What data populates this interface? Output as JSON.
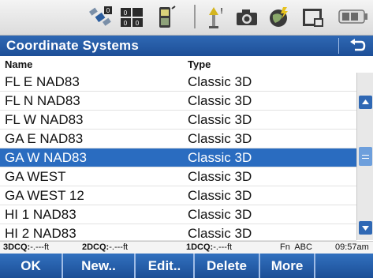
{
  "toolbar": {
    "icons": [
      "gps-satellite-icon",
      "correction-status-icon",
      "data-collector-icon",
      "tilt-sensor-icon",
      "camera-icon",
      "internet-globe-icon",
      "status-screen-icon",
      "battery-icon"
    ]
  },
  "header": {
    "title": "Coordinate Systems"
  },
  "columns": {
    "name": "Name",
    "type": "Type"
  },
  "rows": [
    {
      "name": "FL E NAD83",
      "type": "Classic 3D",
      "selected": false
    },
    {
      "name": "FL N NAD83",
      "type": "Classic 3D",
      "selected": false
    },
    {
      "name": "FL W NAD83",
      "type": "Classic 3D",
      "selected": false
    },
    {
      "name": "GA E NAD83",
      "type": "Classic 3D",
      "selected": false
    },
    {
      "name": "GA W NAD83",
      "type": "Classic 3D",
      "selected": true
    },
    {
      "name": "GA WEST",
      "type": "Classic 3D",
      "selected": false
    },
    {
      "name": "GA WEST 12",
      "type": "Classic 3D",
      "selected": false
    },
    {
      "name": "HI 1 NAD83",
      "type": "Classic 3D",
      "selected": false
    },
    {
      "name": "HI 2 NAD83",
      "type": "Classic 3D",
      "selected": false
    }
  ],
  "status": {
    "q3": "3DCQ:",
    "q3_val": "-.---ft",
    "q2": "2DCQ:",
    "q2_val": "-.---ft",
    "q1": "1DCQ:",
    "q1_val": "-.---ft",
    "mode": "Fn  ABC",
    "time": "09:57am"
  },
  "softkeys": [
    "OK",
    "New..",
    "Edit..",
    "Delete",
    "More"
  ],
  "colors": {
    "accent": "#2a6cc0",
    "titlebar": "#1d4f97",
    "toolbar_bg": "#e6e6e6"
  }
}
